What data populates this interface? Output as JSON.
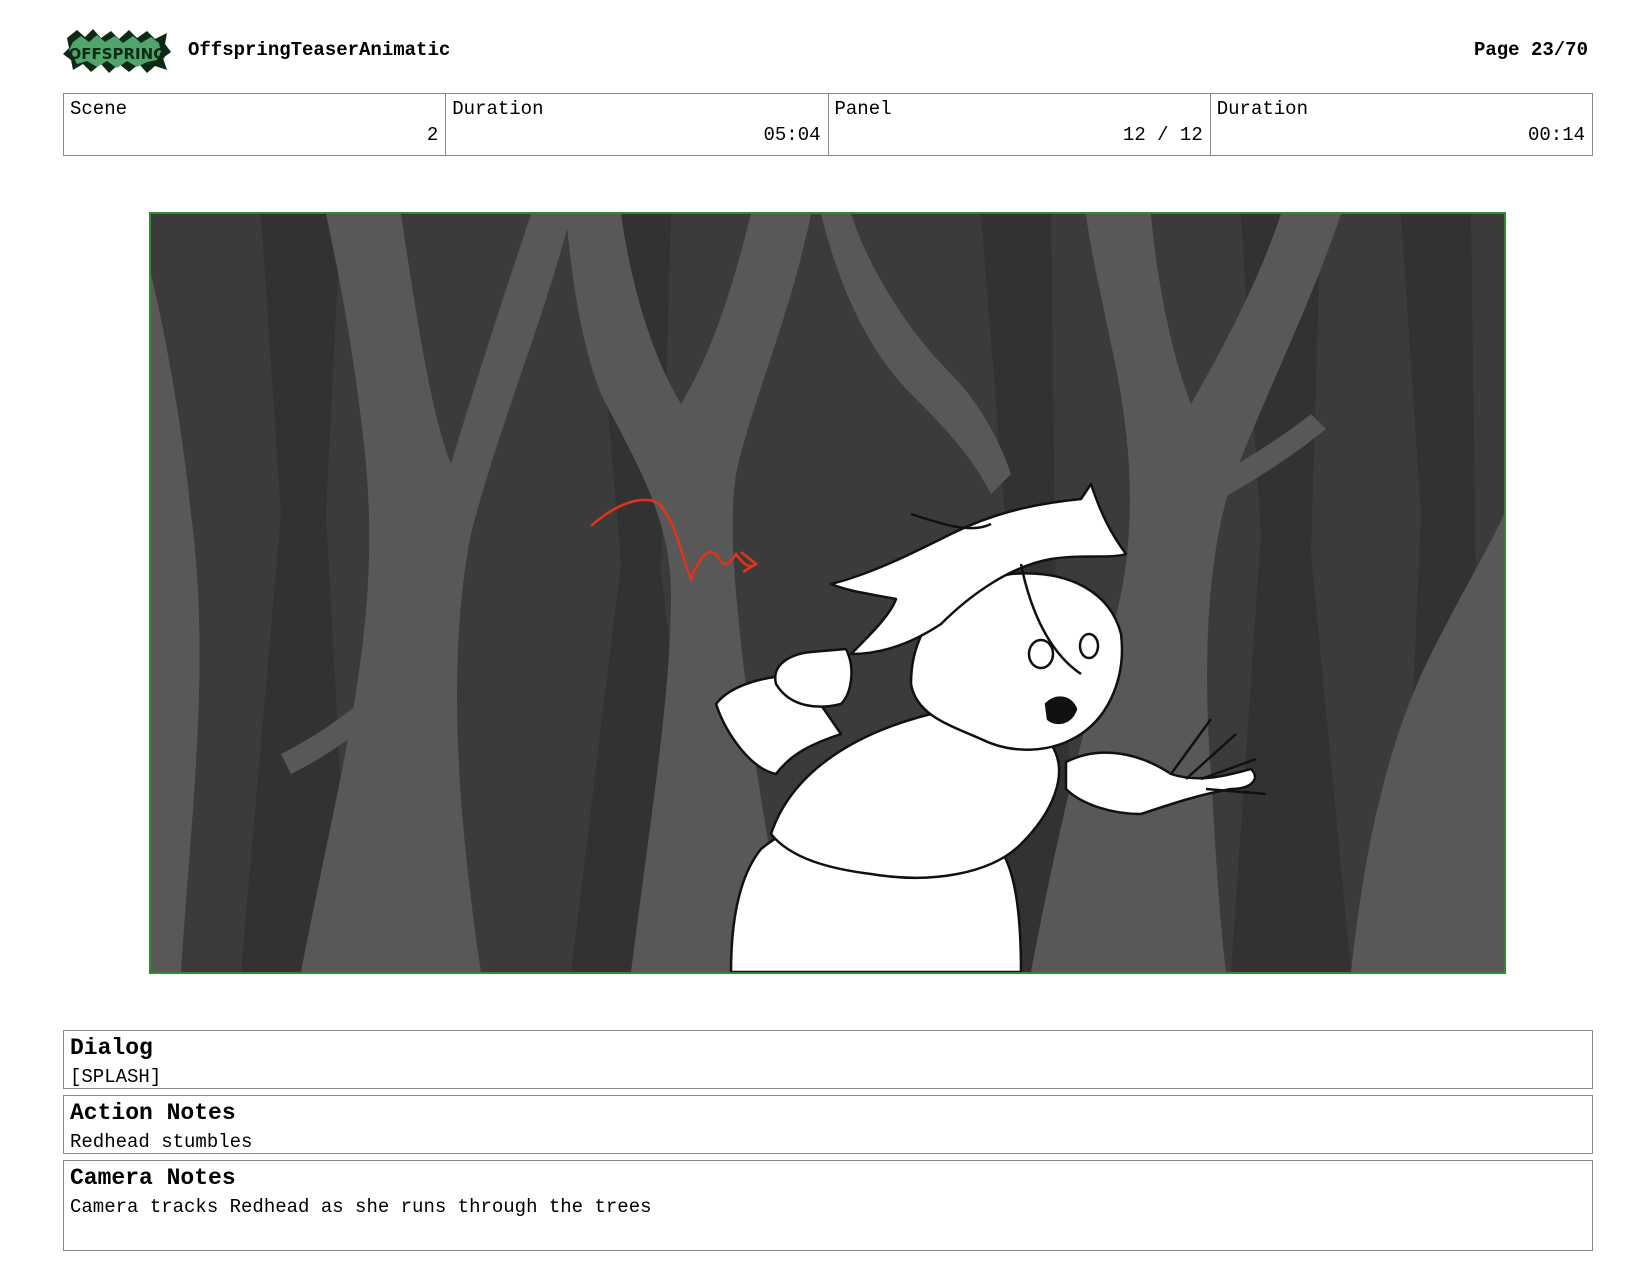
{
  "header": {
    "logo_text": "OFFSPRING",
    "project_title": "OffspringTeaserAnimatic",
    "page_label": "Page 23/70"
  },
  "info": [
    {
      "label": "Scene",
      "value": "2"
    },
    {
      "label": "Duration",
      "value": "05:04"
    },
    {
      "label": "Panel",
      "value": "12 / 12"
    },
    {
      "label": "Duration",
      "value": "00:14"
    }
  ],
  "notes": {
    "dialog": {
      "title": "Dialog",
      "text": "[SPLASH]"
    },
    "action": {
      "title": "Action Notes",
      "text": "Redhead stumbles"
    },
    "camera": {
      "title": "Camera Notes",
      "text": "Camera tracks Redhead as she runs through the trees"
    }
  },
  "colors": {
    "panel_border": "#2e8b2e",
    "arrow": "#e0341c",
    "logo": "#4fa56a"
  }
}
